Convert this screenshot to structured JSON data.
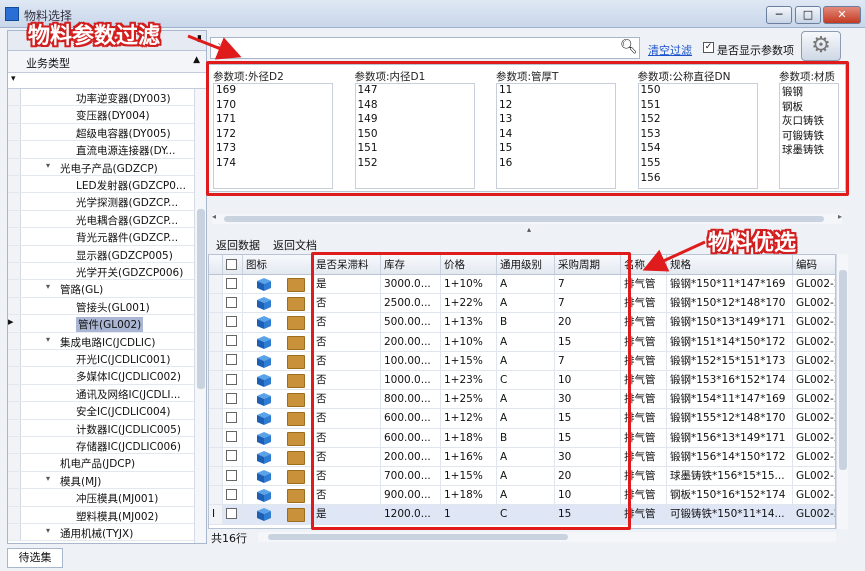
{
  "window": {
    "title": "物料选择",
    "min": "─",
    "max": "□",
    "close": "✕"
  },
  "left": {
    "header_pin": "▮",
    "column_title": "业务类型",
    "filter_icon": "funnel-icon",
    "tree": [
      {
        "label": "功率逆变器(DY003)",
        "level": 2
      },
      {
        "label": "变压器(DY004)",
        "level": 2
      },
      {
        "label": "超级电容器(DY005)",
        "level": 2
      },
      {
        "label": "直流电源连接器(DY...",
        "level": 2
      },
      {
        "label": "光电子产品(GDZCP)",
        "level": 1,
        "expanded": true
      },
      {
        "label": "LED发射器(GDZCP0...",
        "level": 2
      },
      {
        "label": "光学探测器(GDZCP...",
        "level": 2
      },
      {
        "label": "光电耦合器(GDZCP...",
        "level": 2
      },
      {
        "label": "背光元器件(GDZCP...",
        "level": 2
      },
      {
        "label": "显示器(GDZCP005)",
        "level": 2
      },
      {
        "label": "光学开关(GDZCP006)",
        "level": 2
      },
      {
        "label": "管路(GL)",
        "level": 1,
        "expanded": true
      },
      {
        "label": "管接头(GL001)",
        "level": 2
      },
      {
        "label": "管件(GL002)",
        "level": 2,
        "selected": true
      },
      {
        "label": "集成电路IC(JCDLIC)",
        "level": 1,
        "expanded": true
      },
      {
        "label": "开光IC(JCDLIC001)",
        "level": 2
      },
      {
        "label": "多媒体IC(JCDLIC002)",
        "level": 2
      },
      {
        "label": "通讯及网络IC(JCDLI...",
        "level": 2
      },
      {
        "label": "安全IC(JCDLIC004)",
        "level": 2
      },
      {
        "label": "计数器IC(JCDLIC005)",
        "level": 2
      },
      {
        "label": "存储器IC(JCDLIC006)",
        "level": 2
      },
      {
        "label": "机电产品(JDCP)",
        "level": 1
      },
      {
        "label": "模具(MJ)",
        "level": 1,
        "expanded": true
      },
      {
        "label": "冲压模具(MJ001)",
        "level": 2
      },
      {
        "label": "塑料模具(MJ002)",
        "level": 2
      },
      {
        "label": "通用机械(TYJX)",
        "level": 1,
        "expanded": true
      }
    ],
    "pending_tab": "待选集"
  },
  "search": {
    "placeholder": "请",
    "icon": "search-icon",
    "clear": "清空过滤",
    "show_params_label": "是否显示参数项",
    "show_params_checked": true
  },
  "params": [
    {
      "title": "参数项:外径D2",
      "values": [
        "169",
        "170",
        "171",
        "172",
        "173",
        "174"
      ]
    },
    {
      "title": "参数项:内径D1",
      "values": [
        "147",
        "148",
        "149",
        "150",
        "151",
        "152"
      ]
    },
    {
      "title": "参数项:管厚T",
      "values": [
        "11",
        "12",
        "13",
        "14",
        "15",
        "16"
      ]
    },
    {
      "title": "参数项:公称直径DN",
      "values": [
        "150",
        "151",
        "152",
        "153",
        "154",
        "155",
        "156"
      ]
    },
    {
      "title": "参数项:材质",
      "values": [
        "锻钢",
        "钢板",
        "灰口铸铁",
        "可锻铸铁",
        "球墨铸铁"
      ]
    }
  ],
  "toolbar": {
    "return_data": "返回数据",
    "return_doc": "返回文档"
  },
  "grid": {
    "headers": {
      "icon": "图标",
      "stagnant": "是否呆滞料",
      "stock": "库存",
      "price": "价格",
      "level": "通用级别",
      "cycle": "采购周期",
      "name": "名称",
      "spec": "规格",
      "code": "编码"
    },
    "rows": [
      {
        "stagnant": "是",
        "stock": "3000.0...",
        "price": "1+10%",
        "level": "A",
        "cycle": "7",
        "name": "排气管",
        "spec": "锻钢*150*11*147*169",
        "code": "GL002-2"
      },
      {
        "stagnant": "否",
        "stock": "2500.0...",
        "price": "1+22%",
        "level": "A",
        "cycle": "7",
        "name": "排气管",
        "spec": "锻钢*150*12*148*170",
        "code": "GL002-2"
      },
      {
        "stagnant": "否",
        "stock": "500.00...",
        "price": "1+13%",
        "level": "B",
        "cycle": "20",
        "name": "排气管",
        "spec": "锻钢*150*13*149*171",
        "code": "GL002-2"
      },
      {
        "stagnant": "否",
        "stock": "200.00...",
        "price": "1+10%",
        "level": "A",
        "cycle": "15",
        "name": "排气管",
        "spec": "锻钢*151*14*150*172",
        "code": "GL002-2"
      },
      {
        "stagnant": "否",
        "stock": "100.00...",
        "price": "1+15%",
        "level": "A",
        "cycle": "7",
        "name": "排气管",
        "spec": "锻钢*152*15*151*173",
        "code": "GL002-2"
      },
      {
        "stagnant": "否",
        "stock": "1000.0...",
        "price": "1+23%",
        "level": "C",
        "cycle": "10",
        "name": "排气管",
        "spec": "锻钢*153*16*152*174",
        "code": "GL002-2"
      },
      {
        "stagnant": "否",
        "stock": "800.00...",
        "price": "1+25%",
        "level": "A",
        "cycle": "30",
        "name": "排气管",
        "spec": "锻钢*154*11*147*169",
        "code": "GL002-2"
      },
      {
        "stagnant": "否",
        "stock": "600.00...",
        "price": "1+12%",
        "level": "A",
        "cycle": "15",
        "name": "排气管",
        "spec": "锻钢*155*12*148*170",
        "code": "GL002-2"
      },
      {
        "stagnant": "否",
        "stock": "600.00...",
        "price": "1+18%",
        "level": "B",
        "cycle": "15",
        "name": "排气管",
        "spec": "锻钢*156*13*149*171",
        "code": "GL002-2"
      },
      {
        "stagnant": "否",
        "stock": "200.00...",
        "price": "1+16%",
        "level": "A",
        "cycle": "30",
        "name": "排气管",
        "spec": "锻钢*156*14*150*172",
        "code": "GL002-2"
      },
      {
        "stagnant": "否",
        "stock": "700.00...",
        "price": "1+15%",
        "level": "A",
        "cycle": "20",
        "name": "排气管",
        "spec": "球墨铸铁*156*15*15...",
        "code": "GL002-2"
      },
      {
        "stagnant": "否",
        "stock": "900.00...",
        "price": "1+18%",
        "level": "A",
        "cycle": "10",
        "name": "排气管",
        "spec": "钢板*150*16*152*174",
        "code": "GL002-2"
      },
      {
        "stagnant": "是",
        "stock": "1200.0...",
        "price": "1",
        "level": "C",
        "cycle": "15",
        "name": "排气管",
        "spec": "可锻铸铁*150*11*14...",
        "code": "GL002-2",
        "selected": true,
        "cursor": "I"
      }
    ],
    "row_count": "共16行"
  },
  "annotations": {
    "filter_title": "物料参数过滤",
    "preferred_title": "物料优选",
    "color": "#e01b1b"
  }
}
